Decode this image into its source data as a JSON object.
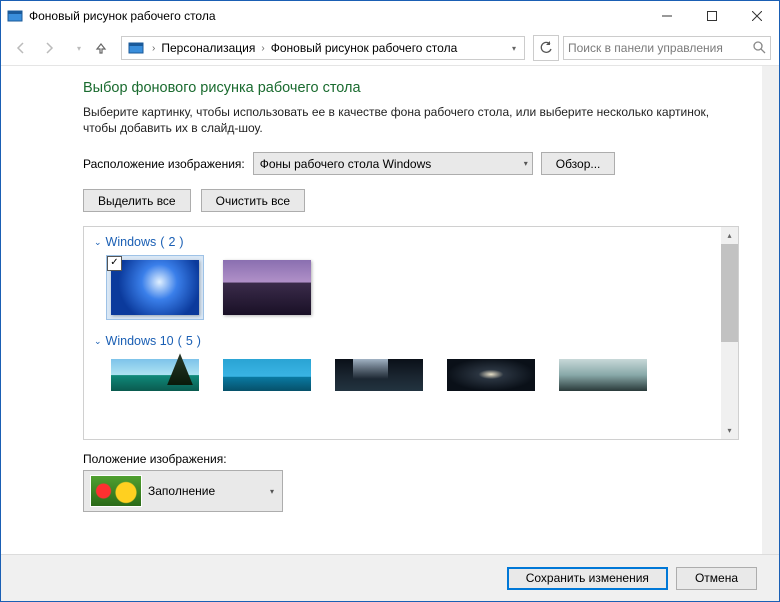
{
  "window": {
    "title": "Фоновый рисунок рабочего стола"
  },
  "nav": {
    "breadcrumb": [
      "Персонализация",
      "Фоновый рисунок рабочего стола"
    ],
    "search_placeholder": "Поиск в панели управления"
  },
  "page": {
    "heading": "Выбор фонового рисунка рабочего стола",
    "description": "Выберите картинку, чтобы использовать ее в качестве фона рабочего стола, или выберите несколько картинок, чтобы добавить их в слайд-шоу.",
    "location_label": "Расположение изображения:",
    "location_value": "Фоны рабочего стола Windows",
    "browse": "Обзор...",
    "select_all": "Выделить все",
    "clear_all": "Очистить все"
  },
  "groups": [
    {
      "name": "Windows",
      "count": 2
    },
    {
      "name": "Windows 10",
      "count": 5
    }
  ],
  "position": {
    "label": "Положение изображения:",
    "value": "Заполнение"
  },
  "footer": {
    "save": "Сохранить изменения",
    "cancel": "Отмена"
  }
}
